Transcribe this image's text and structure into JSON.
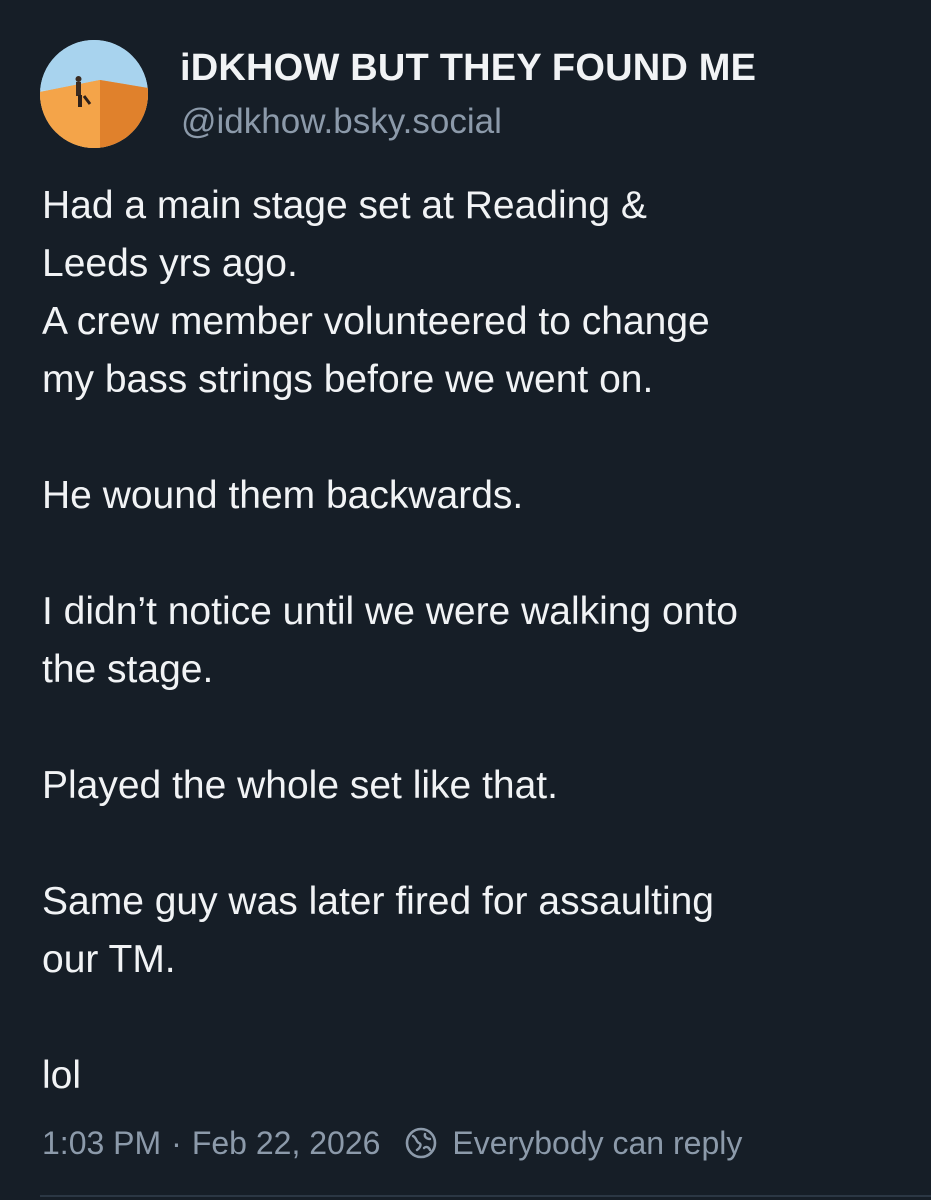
{
  "author": {
    "display_name": "iDKHOW BUT THEY FOUND ME",
    "handle": "@idkhow.bsky.social",
    "avatar_icon": "profile-photo-orange-wall"
  },
  "post": {
    "paragraphs": [
      "Had a main stage set at Reading &\nLeeds yrs ago.\nA crew member volunteered to change\nmy bass strings before we went on.",
      "He wound them backwards.",
      "I didn’t notice until we were walking onto\nthe stage.",
      "Played the whole set like that.",
      "Same guy was later fired for assaulting\nour TM.",
      "lol"
    ]
  },
  "meta": {
    "time": "1:03 PM",
    "separator": "·",
    "date": "Feb 22, 2026",
    "reply_icon": "globe-icon",
    "reply_setting": "Everybody can reply"
  },
  "colors": {
    "background": "#161e27",
    "text": "#f1f3f5",
    "muted": "#8c9aaa"
  }
}
